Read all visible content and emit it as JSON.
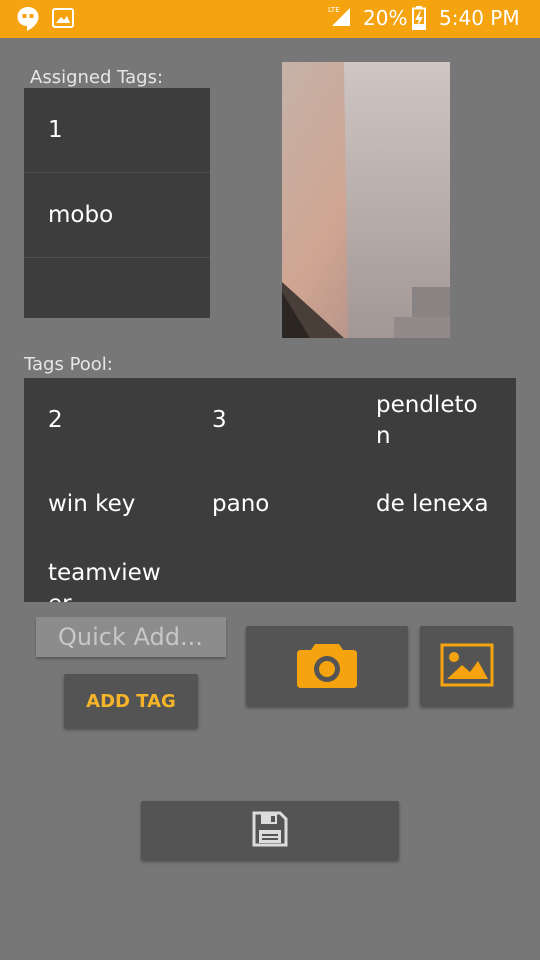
{
  "status_bar": {
    "battery_percent": "20%",
    "time": "5:40 PM",
    "network": "LTE"
  },
  "labels": {
    "assigned_tags": "Assigned Tags:",
    "tags_pool": "Tags Pool:"
  },
  "assigned_tags": [
    "1",
    "mobo",
    ""
  ],
  "tags_pool": [
    "2",
    "3",
    "pendleton",
    "win key",
    "pano",
    "de lenexa",
    "teamviewer"
  ],
  "quick_add": {
    "placeholder": "Quick Add...",
    "value": ""
  },
  "buttons": {
    "add_tag": "ADD TAG"
  },
  "colors": {
    "accent": "#F5A30F",
    "background": "#777777",
    "panel": "#3d3d3d",
    "button": "#545454"
  },
  "icons": [
    "hangouts-icon",
    "image-icon",
    "signal-icon",
    "battery-charging-icon",
    "camera-icon",
    "gallery-icon",
    "save-icon"
  ]
}
